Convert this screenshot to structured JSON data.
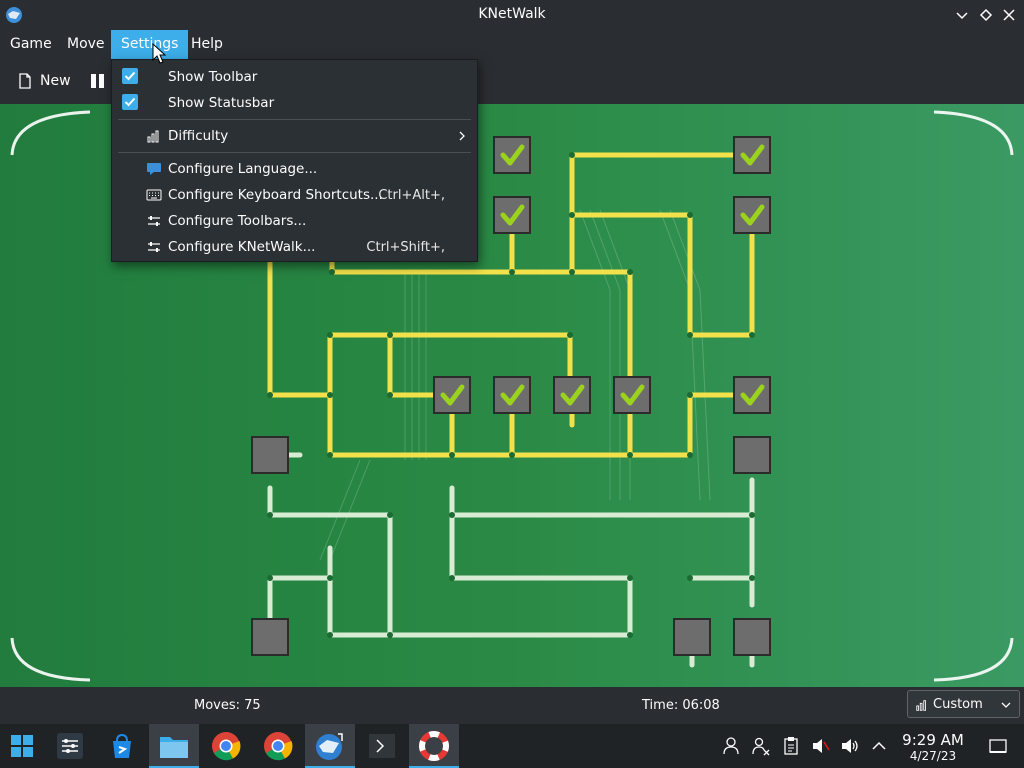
{
  "window": {
    "title": "KNetWalk"
  },
  "menubar": {
    "items": [
      "Game",
      "Move",
      "Settings",
      "Help"
    ]
  },
  "toolbar": {
    "new_label": "New"
  },
  "settings_menu": {
    "show_toolbar": "Show Toolbar",
    "show_statusbar": "Show Statusbar",
    "difficulty": "Difficulty",
    "configure_language": "Configure Language...",
    "configure_shortcuts": "Configure Keyboard Shortcuts...",
    "configure_shortcuts_key": "Ctrl+Alt+,",
    "configure_toolbars": "Configure Toolbars...",
    "configure_app": "Configure KNetWalk...",
    "configure_app_key": "Ctrl+Shift+,"
  },
  "statusbar": {
    "moves": "Moves: 75",
    "time": "Time: 06:08",
    "difficulty_value": "Custom"
  },
  "clock": {
    "time": "9:29 AM",
    "date": "4/27/23"
  },
  "colors": {
    "accent": "#3daee9",
    "board_green": "#2a8a45",
    "connected_wire": "#f2e14a",
    "unconnected_wire": "#d7ecd2"
  },
  "icons": {
    "titlebar": [
      "knetwalk-app-icon",
      "minimize-icon",
      "maximize-icon",
      "close-icon"
    ],
    "taskbar": [
      "start-menu-icon",
      "system-settings-icon",
      "discover-icon",
      "file-manager-icon",
      "chrome-icon",
      "chrome-icon",
      "knetwalk-icon",
      "terminal-icon",
      "help-lifebuoy-icon"
    ],
    "tray": [
      "user-icon",
      "users-icon",
      "clipboard-icon",
      "mute-icon",
      "volume-icon",
      "tray-expand-icon",
      "show-desktop-icon"
    ]
  }
}
